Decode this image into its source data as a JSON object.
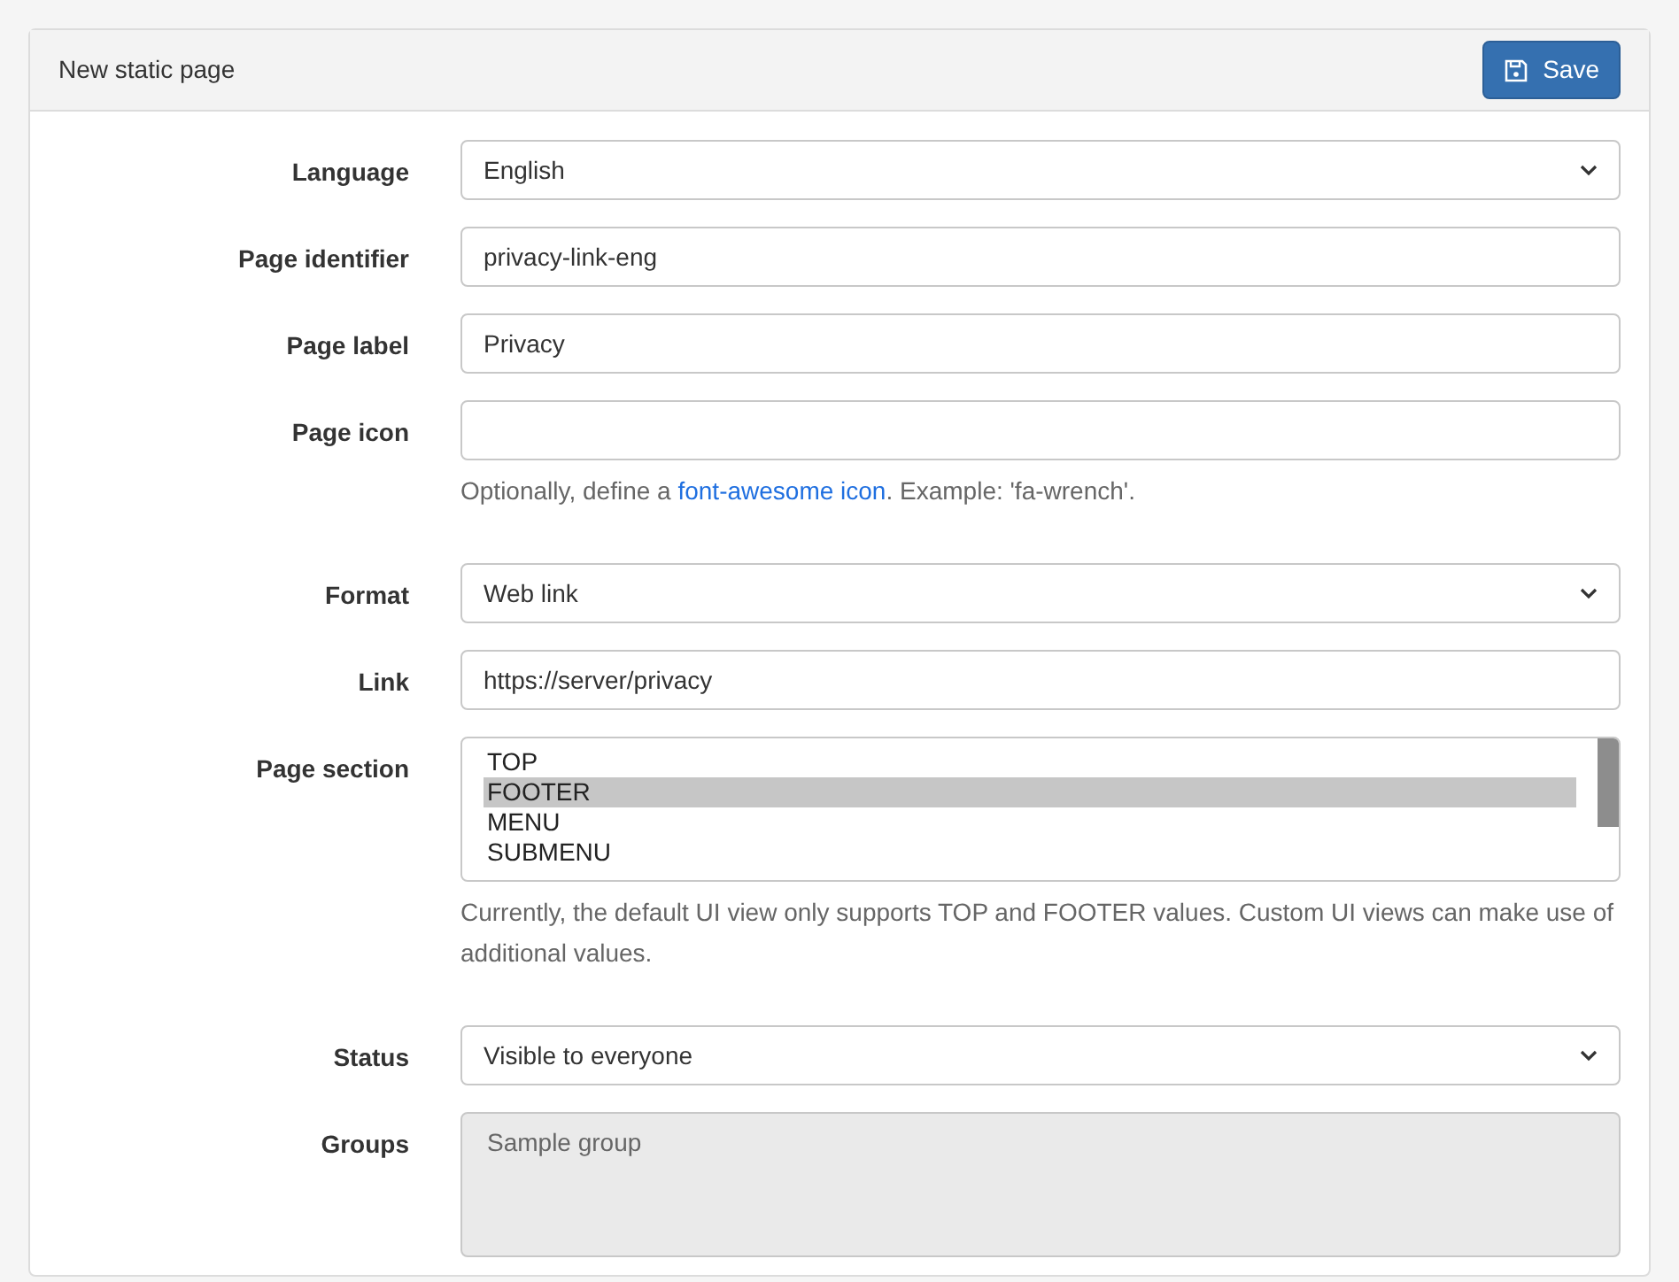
{
  "panel": {
    "title": "New static page",
    "save_button": "Save"
  },
  "fields": [
    {
      "kind": "select",
      "label": "Language",
      "value": "English"
    },
    {
      "kind": "text",
      "label": "Page identifier",
      "value": "privacy-link-eng"
    },
    {
      "kind": "text",
      "label": "Page label",
      "value": "Privacy"
    },
    {
      "kind": "text",
      "label": "Page icon",
      "help": {
        "before": "Optionally, define a ",
        "link": "font-awesome icon",
        "after": ". Example: 'fa-wrench'."
      }
    },
    {
      "kind": "select",
      "label": "Format",
      "value": "Web link"
    },
    {
      "kind": "text",
      "label": "Link",
      "value": "https://server/privacy"
    },
    {
      "kind": "listbox",
      "label": "Page section",
      "options": [
        {
          "text": "TOP",
          "selected": false
        },
        {
          "text": "FOOTER",
          "selected": true
        },
        {
          "text": "MENU",
          "selected": false
        },
        {
          "text": "SUBMENU",
          "selected": false
        }
      ],
      "help": {
        "before": "Currently, the default UI view only supports TOP and FOOTER values. Custom UI views can make use of additional values."
      }
    },
    {
      "kind": "select",
      "label": "Status",
      "value": "Visible to everyone"
    },
    {
      "kind": "multiselect",
      "label": "Groups",
      "options": [
        {
          "text": "Sample group",
          "selected": false
        }
      ]
    }
  ]
}
